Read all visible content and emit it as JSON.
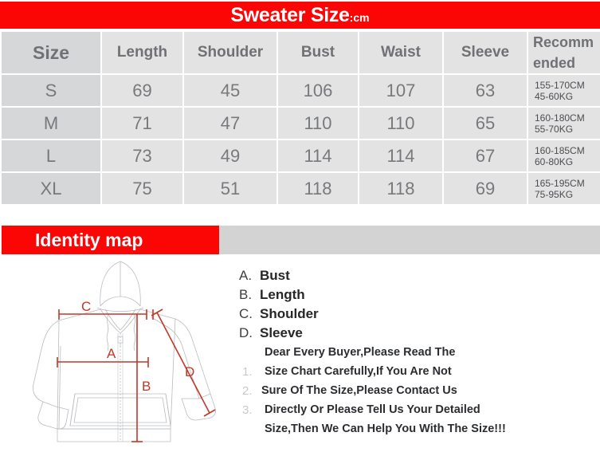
{
  "title": {
    "main": "Sweater Size",
    "unit": ":cm"
  },
  "table": {
    "columns": [
      "Size",
      "Length",
      "Shoulder",
      "Bust",
      "Waist",
      "Sleeve",
      "Recommended"
    ],
    "recommended_header_line1": "Recomm",
    "recommended_header_line2": "ended",
    "rows": [
      {
        "size": "S",
        "length": "69",
        "shoulder": "45",
        "bust": "106",
        "waist": "107",
        "sleeve": "63",
        "rec_height": "155-170CM",
        "rec_weight": "45-60KG"
      },
      {
        "size": "M",
        "length": "71",
        "shoulder": "47",
        "bust": "110",
        "waist": "110",
        "sleeve": "65",
        "rec_height": "160-180CM",
        "rec_weight": "55-70KG"
      },
      {
        "size": "L",
        "length": "73",
        "shoulder": "49",
        "bust": "114",
        "waist": "114",
        "sleeve": "67",
        "rec_height": "160-185CM",
        "rec_weight": "60-80KG"
      },
      {
        "size": "XL",
        "length": "75",
        "shoulder": "51",
        "bust": "118",
        "waist": "118",
        "sleeve": "69",
        "rec_height": "165-195CM",
        "rec_weight": "75-95KG"
      }
    ]
  },
  "identity_map": {
    "title": "Identity map",
    "legend": [
      {
        "letter": "A.",
        "label": "Bust"
      },
      {
        "letter": "B.",
        "label": "Length"
      },
      {
        "letter": "C.",
        "label": "Shoulder"
      },
      {
        "letter": "D.",
        "label": "Sleeve"
      }
    ],
    "diagram_labels": {
      "a": "A",
      "b": "B",
      "c": "C",
      "d": "D"
    }
  },
  "notes": {
    "numbers": [
      "1.",
      "2.",
      "3."
    ],
    "lines": [
      "Dear Every Buyer,Please Read The",
      "Size Chart Carefully,If You Are Not",
      "Sure Of The Size,Please Contact Us",
      "Directly Or Please Tell Us Your Detailed",
      "Size,Then We Can Help You With The Size!!!"
    ]
  },
  "colors": {
    "banner_red": "#fc0505",
    "cell_gray": "#e3e3e4",
    "size_col_gray": "#d6d7d8",
    "bar_gray": "#d3d3d3",
    "measure_red": "#c0392b",
    "text_gray": "#77797c"
  }
}
